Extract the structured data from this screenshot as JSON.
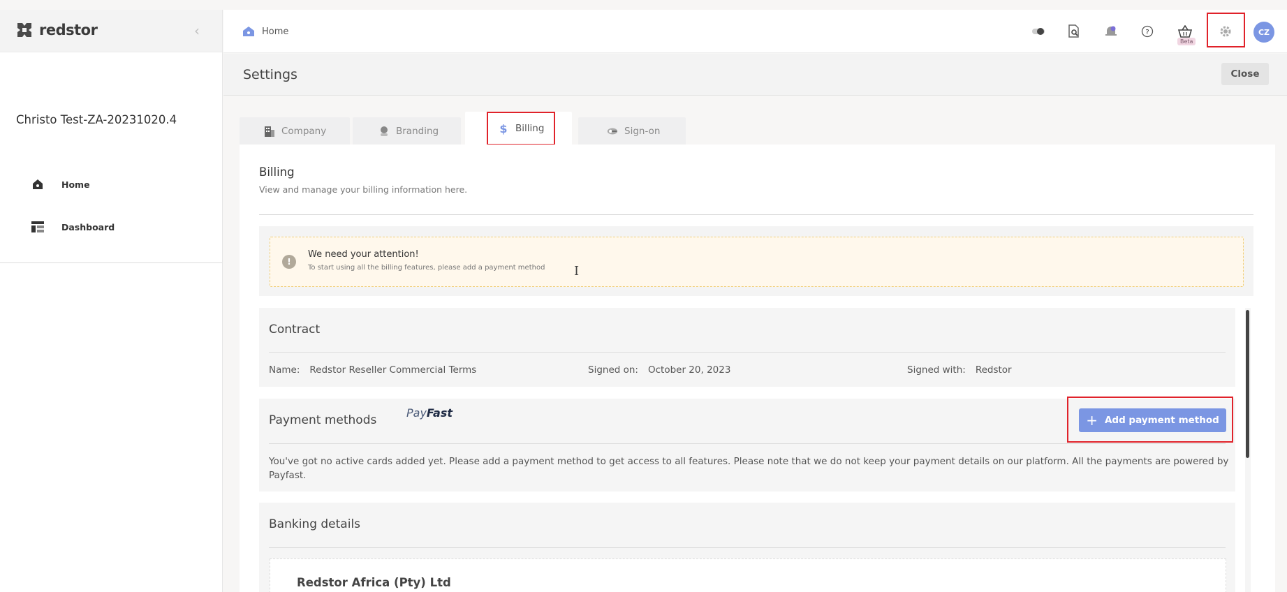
{
  "app": {
    "logo_text": "redstor"
  },
  "sidebar": {
    "account_name": "Christo Test-ZA-20231020.4",
    "items": [
      {
        "label": "Home",
        "icon": "home-icon"
      },
      {
        "label": "Dashboard",
        "icon": "dashboard-icon"
      }
    ]
  },
  "topbar": {
    "breadcrumb": "Home",
    "icons": [
      "toggle-icon",
      "search-document-icon",
      "bell-icon",
      "help-icon",
      "basket-icon",
      "gear-icon"
    ],
    "beta_label": "Beta",
    "avatar_initials": "CZ"
  },
  "settings": {
    "title": "Settings",
    "close_label": "Close",
    "tabs": [
      {
        "label": "Company",
        "icon": "building-icon"
      },
      {
        "label": "Branding",
        "icon": "brush-icon"
      },
      {
        "label": "Billing",
        "icon": "dollar-icon",
        "active": true
      },
      {
        "label": "Sign-on",
        "icon": "key-cloud-icon"
      }
    ]
  },
  "billing": {
    "title": "Billing",
    "subtitle": "View and manage your billing information here.",
    "alert": {
      "title": "We need your attention!",
      "text": "To start using all the billing features, please add a payment method"
    },
    "contract": {
      "title": "Contract",
      "name_label": "Name:",
      "name_value": "Redstor Reseller Commercial Terms",
      "signed_on_label": "Signed on:",
      "signed_on_value": "October 20, 2023",
      "signed_with_label": "Signed with:",
      "signed_with_value": "Redstor"
    },
    "payment": {
      "title": "Payment methods",
      "provider_logo_a": "Pay",
      "provider_logo_b": "Fast",
      "add_label": "Add payment method",
      "note": "You've got no active cards added yet. Please add a payment method to get access to all features. Please note that we do not keep your payment details on our platform. All the payments are powered by Payfast."
    },
    "banking": {
      "title": "Banking details",
      "company": "Redstor Africa (Pty) Ltd"
    }
  },
  "colors": {
    "accent": "#7b96e3",
    "highlight": "#e0222a",
    "alert_bg": "#fff8ec"
  }
}
